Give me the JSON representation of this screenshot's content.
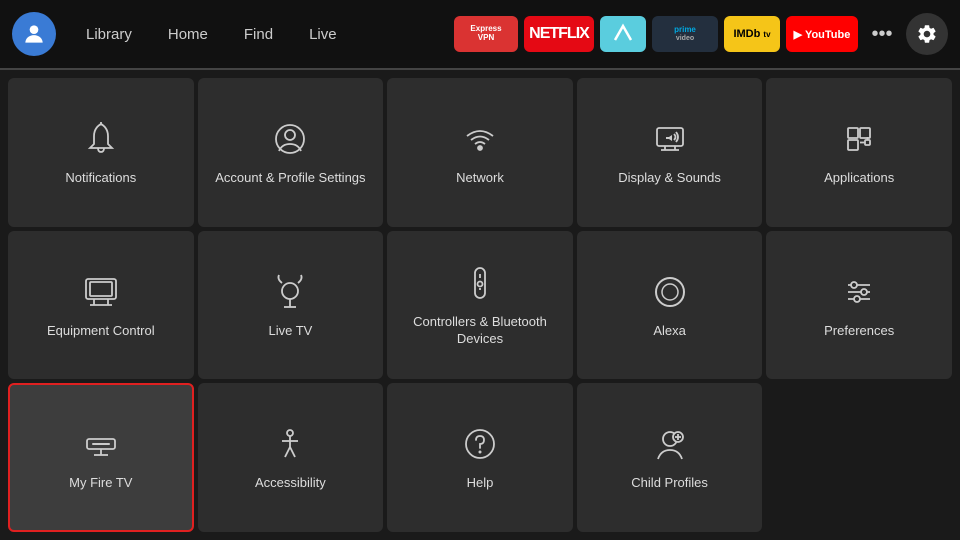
{
  "nav": {
    "links": [
      "Library",
      "Home",
      "Find",
      "Live"
    ],
    "apps": [
      {
        "id": "expressvpn",
        "label": "ExpressVPN"
      },
      {
        "id": "netflix",
        "label": "NETFLIX"
      },
      {
        "id": "freeform",
        "label": ""
      },
      {
        "id": "prime",
        "label": "prime video"
      },
      {
        "id": "imdb",
        "label": "IMDb tv"
      },
      {
        "id": "youtube",
        "label": "▶ YouTube"
      }
    ],
    "more_label": "•••"
  },
  "settings": {
    "tiles": [
      {
        "id": "notifications",
        "label": "Notifications",
        "icon": "bell"
      },
      {
        "id": "account",
        "label": "Account & Profile Settings",
        "icon": "person-circle"
      },
      {
        "id": "network",
        "label": "Network",
        "icon": "wifi"
      },
      {
        "id": "display-sounds",
        "label": "Display & Sounds",
        "icon": "display-sound"
      },
      {
        "id": "applications",
        "label": "Applications",
        "icon": "apps"
      },
      {
        "id": "equipment-control",
        "label": "Equipment Control",
        "icon": "tv-monitor"
      },
      {
        "id": "live-tv",
        "label": "Live TV",
        "icon": "antenna"
      },
      {
        "id": "controllers-bluetooth",
        "label": "Controllers & Bluetooth Devices",
        "icon": "remote"
      },
      {
        "id": "alexa",
        "label": "Alexa",
        "icon": "alexa"
      },
      {
        "id": "preferences",
        "label": "Preferences",
        "icon": "sliders"
      },
      {
        "id": "my-fire-tv",
        "label": "My Fire TV",
        "icon": "fire-tv",
        "selected": true
      },
      {
        "id": "accessibility",
        "label": "Accessibility",
        "icon": "accessibility"
      },
      {
        "id": "help",
        "label": "Help",
        "icon": "help"
      },
      {
        "id": "child-profiles",
        "label": "Child Profiles",
        "icon": "child-profile"
      }
    ]
  }
}
